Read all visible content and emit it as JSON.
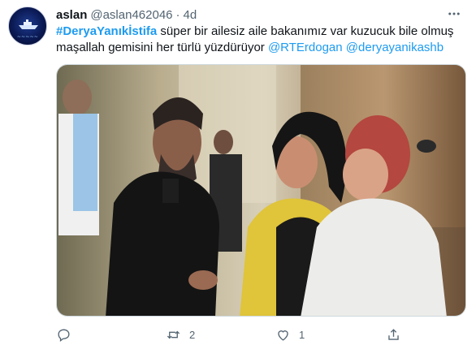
{
  "tweet": {
    "display_name": "aslan",
    "handle": "@aslan462046",
    "separator": "·",
    "time": "4d",
    "text": {
      "hashtag": "#DeryaYanıkİstifa",
      "line1_rest": " süper bir ailesiz aile bakanımız var kuzucuk bile olmuş",
      "line2_start": "maşallah gemisini her türlü yüzdürüyor ",
      "mention1": "@RTErdogan",
      "mention2": "@deryayanikashb"
    },
    "actions": {
      "reply_count": "",
      "retweet_count": "2",
      "like_count": "1"
    }
  },
  "icons": {
    "more": "more-horizontal-icon",
    "reply": "reply-icon",
    "retweet": "retweet-icon",
    "like": "heart-icon",
    "share": "share-icon"
  },
  "colors": {
    "link": "#1d9bf0",
    "secondary_text": "#536471",
    "primary_text": "#0f1419"
  }
}
